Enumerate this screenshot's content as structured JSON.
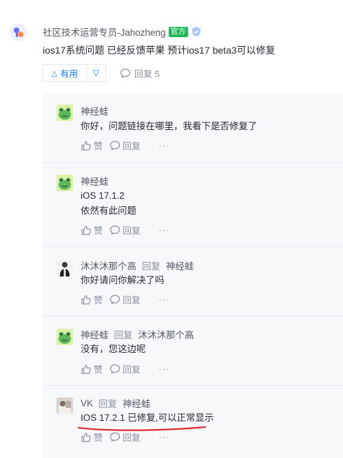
{
  "comment": {
    "author": "社区技术运营专员-Jahozheng",
    "badge": "官方",
    "text": "ios17系统问题 已经反馈苹果 预计ios17 beta3可以修复",
    "up_label": "有用",
    "reply_label": "回复 5"
  },
  "labels": {
    "like": "赞",
    "reply": "回复",
    "more": "···"
  },
  "replies": [
    {
      "user": "神经蛙",
      "text": "你好，问题链接在哪里，我看下是否修复了"
    },
    {
      "user": "神经蛙",
      "lines": [
        "iOS 17.1.2",
        "依然有此问题"
      ]
    },
    {
      "user": "沐沐沐那个高",
      "reply_word": "回复",
      "target": "神经蛙",
      "text": "你好请问你解决了吗"
    },
    {
      "user": "神经蛙",
      "reply_word": "回复",
      "target": "沐沐沐那个高",
      "text": "没有，您这边呢"
    },
    {
      "user": "VK",
      "reply_word": "回复",
      "target": "神经蛙",
      "text": "IOS 17.2.1 已修复,可以正常显示"
    }
  ],
  "colors": {
    "accent": "#1e80ff",
    "official_green": "#1fb955",
    "annotation_red": "#e0282e"
  }
}
